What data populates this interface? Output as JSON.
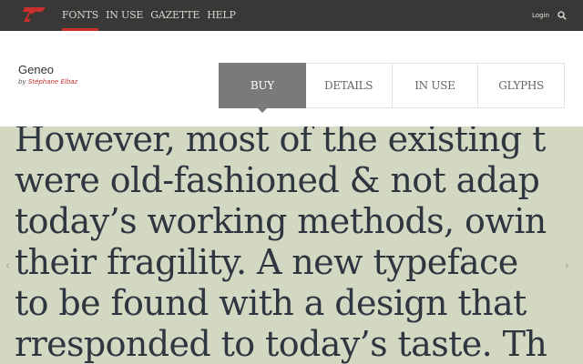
{
  "nav": {
    "items": [
      {
        "label": "FONTS",
        "active": true
      },
      {
        "label": "IN USE",
        "active": false
      },
      {
        "label": "GAZETTE",
        "active": false
      },
      {
        "label": "HELP",
        "active": false
      }
    ],
    "login_label": "Login",
    "search_icon": "search-icon",
    "logo_icon": "brand-logo-icon",
    "accent_color": "#c8302e"
  },
  "header": {
    "font_name": "Geneo",
    "by_label": "by",
    "designer": "Stéphane Elbaz"
  },
  "tabs": [
    {
      "label": "BUY",
      "active": true
    },
    {
      "label": "DETAILS",
      "active": false
    },
    {
      "label": "IN USE",
      "active": false
    },
    {
      "label": "GLYPHS",
      "active": false
    }
  ],
  "specimen": {
    "background": "#d3d8c2",
    "lines": [
      "However, most of the existing t",
      "were old-fashioned & not adap",
      "today’s working methods, owin",
      "their fragility. A new typeface",
      "to be found with a design that",
      "rresponded to today’s taste. Th"
    ],
    "prev_arrow": "‹",
    "next_arrow": "›"
  }
}
